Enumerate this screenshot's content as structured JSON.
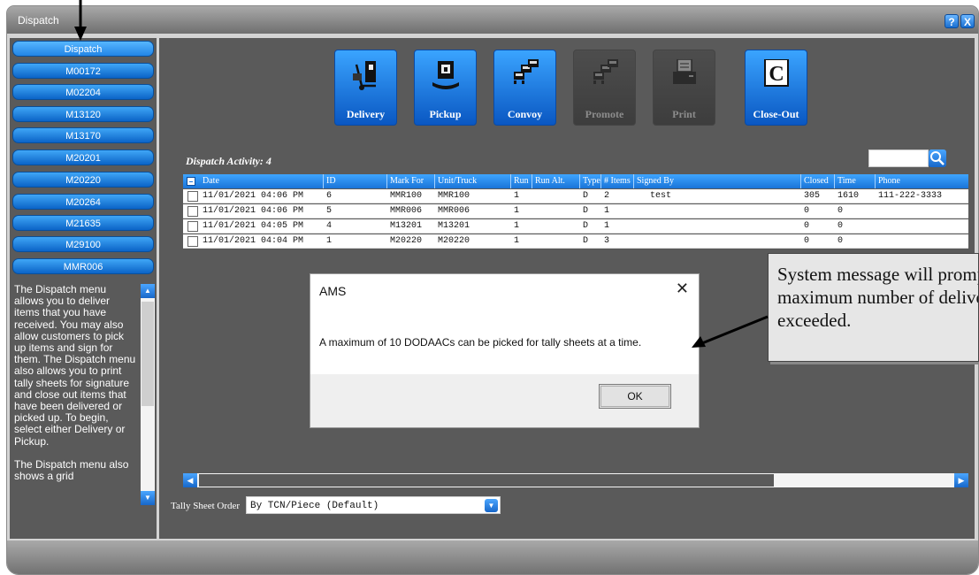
{
  "window": {
    "title": "Dispatch",
    "help_symbol": "?",
    "close_symbol": "X"
  },
  "sidebar": {
    "items": [
      {
        "label": "Dispatch"
      },
      {
        "label": "M00172"
      },
      {
        "label": "M02204"
      },
      {
        "label": "M13120"
      },
      {
        "label": "M13170"
      },
      {
        "label": "M20201"
      },
      {
        "label": "M20220"
      },
      {
        "label": "M20264"
      },
      {
        "label": "M21635"
      },
      {
        "label": "M29100"
      },
      {
        "label": "MMR006"
      }
    ],
    "help_text": "The Dispatch menu allows you to deliver items that you have received. You may also allow customers to pick up items and sign for them. The Dispatch menu also allows you to print tally sheets for signature and close out items that have been delivered or picked up. To begin, select either Delivery or Pickup.\n\nThe Dispatch menu also shows a grid"
  },
  "toolbar": {
    "buttons": [
      {
        "label": "Delivery",
        "icon": "hand-truck-icon",
        "enabled": true
      },
      {
        "label": "Pickup",
        "icon": "package-hand-icon",
        "enabled": true
      },
      {
        "label": "Convoy",
        "icon": "convoy-trucks-icon",
        "enabled": true
      },
      {
        "label": "Promote",
        "icon": "convoy-trucks-icon",
        "enabled": false
      },
      {
        "label": "Print",
        "icon": "printer-icon",
        "enabled": false
      },
      {
        "label": "Close-Out",
        "icon": "close-out-c-icon",
        "enabled": true
      }
    ]
  },
  "activity": {
    "label": "Dispatch Activity: 4"
  },
  "grid": {
    "columns": [
      "Date",
      "ID",
      "Mark For",
      "Unit/Truck",
      "Run",
      "Run Alt.",
      "Type",
      "# Items",
      "Signed By",
      "Closed",
      "Time",
      "Phone"
    ],
    "rows": [
      {
        "date": "11/01/2021 04:06 PM",
        "id": "6",
        "mark_for": "MMR100",
        "unit": "MMR100",
        "run": "1",
        "run_alt": "",
        "type": "D",
        "items": "2",
        "signed_by": "test",
        "closed": "305",
        "time": "1610",
        "phone": "111-222-3333"
      },
      {
        "date": "11/01/2021 04:06 PM",
        "id": "5",
        "mark_for": "MMR006",
        "unit": "MMR006",
        "run": "1",
        "run_alt": "",
        "type": "D",
        "items": "1",
        "signed_by": "",
        "closed": "0",
        "time": "0",
        "phone": ""
      },
      {
        "date": "11/01/2021 04:05 PM",
        "id": "4",
        "mark_for": "M13201",
        "unit": "M13201",
        "run": "1",
        "run_alt": "",
        "type": "D",
        "items": "1",
        "signed_by": "",
        "closed": "0",
        "time": "0",
        "phone": ""
      },
      {
        "date": "11/01/2021 04:04 PM",
        "id": "1",
        "mark_for": "M20220",
        "unit": "M20220",
        "run": "1",
        "run_alt": "",
        "type": "D",
        "items": "3",
        "signed_by": "",
        "closed": "0",
        "time": "0",
        "phone": ""
      }
    ]
  },
  "tally": {
    "label": "Tally Sheet Order",
    "value": "By TCN/Piece (Default)"
  },
  "dialog": {
    "title": "AMS",
    "message": "A maximum of 10 DODAACs can be picked for tally sheets at a time.",
    "ok_label": "OK",
    "close_symbol": "✕"
  },
  "callout": {
    "text": "System message will prompt if maximum number of deliveries are exceeded."
  },
  "colors": {
    "accent": "#1a74d8",
    "panel": "#5a5a5a",
    "window_bg": "#d4d4d4"
  }
}
